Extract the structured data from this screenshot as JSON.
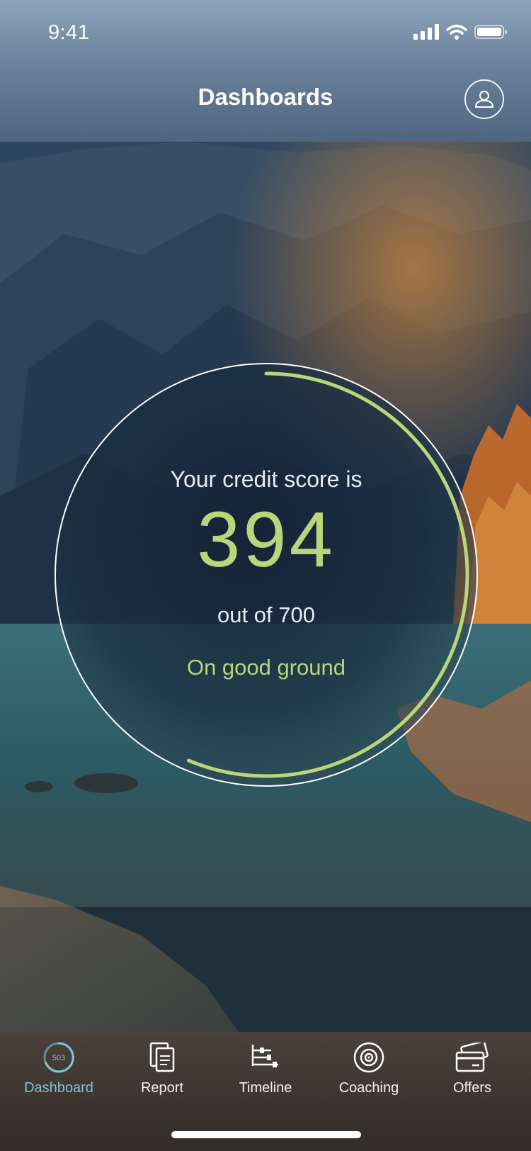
{
  "status_bar": {
    "time": "9:41"
  },
  "header": {
    "title": "Dashboards",
    "profile_icon": "user-icon"
  },
  "score_card": {
    "intro": "Your credit score is",
    "score": "394",
    "out_of": "out of 700",
    "status": "On good ground",
    "progress_fraction": 0.563,
    "accent_color": "#b9d67a"
  },
  "tabbar": {
    "items": [
      {
        "label": "Dashboard",
        "icon": "score-ring-icon",
        "badge": "503",
        "active": true
      },
      {
        "label": "Report",
        "icon": "document-icon",
        "active": false
      },
      {
        "label": "Timeline",
        "icon": "timeline-icon",
        "active": false
      },
      {
        "label": "Coaching",
        "icon": "target-icon",
        "active": false
      },
      {
        "label": "Offers",
        "icon": "cards-icon",
        "active": false
      }
    ]
  }
}
